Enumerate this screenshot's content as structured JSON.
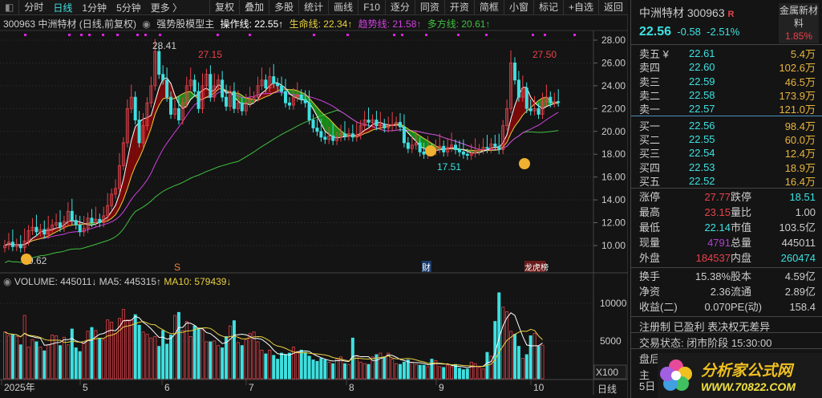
{
  "toolbar": {
    "left": [
      "分时",
      "日线",
      "1分钟",
      "5分钟",
      "更多 〉"
    ],
    "right": [
      "复权",
      "叠加",
      "多股",
      "统计",
      "画线",
      "F10",
      "逐分",
      "同资",
      "开资",
      "简框",
      "小窗",
      "标记",
      "+自选",
      "返回"
    ]
  },
  "info": {
    "title": "300963 中洲特材 (日线,前复权)",
    "model": "强势股模型主",
    "op": "操作线: 22.55↑",
    "life": "生命线: 22.34↑",
    "trend": "趋势线: 21.58↑",
    "multi": "多方线: 20.61↑"
  },
  "colors": {
    "up": "#e8414a",
    "down": "#3ee0e0",
    "ma5": "#ffffff",
    "ma10": "#e8d040",
    "ma20": "#d040e0",
    "ma60": "#40c040"
  },
  "chart_data": {
    "type": "candlestick",
    "ylim": [
      8,
      29
    ],
    "yticks": [
      "28.00",
      "26.00",
      "24.00",
      "22.00",
      "20.00",
      "18.00",
      "16.00",
      "14.00",
      "12.00",
      "10.00"
    ],
    "annotations": {
      "high": "28.41",
      "mid": "27.15",
      "recent": "27.50",
      "low": "17.51",
      "start_low": "9.62"
    },
    "markers": [
      "S",
      "财",
      "龙虎榜"
    ],
    "months": [
      "2025年",
      "5",
      "6",
      "7",
      "8",
      "9",
      "10"
    ],
    "close": [
      10.0,
      10.3,
      9.9,
      10.1,
      9.8,
      10.4,
      11.3,
      11.6,
      11.2,
      11.4,
      11.0,
      11.5,
      11.8,
      12.0,
      11.6,
      12.1,
      13.0,
      12.2,
      11.8,
      11.2,
      11.5,
      12.4,
      12.0,
      12.3,
      12.0,
      12.6,
      13.5,
      14.5,
      15.0,
      17.0,
      19.0,
      22.0,
      23.0,
      21.0,
      19.0,
      20.5,
      22.5,
      24.0,
      27.0,
      25.0,
      24.5,
      23.0,
      21.5,
      22.0,
      21.0,
      22.5,
      24.0,
      24.5,
      23.5,
      22.0,
      24.0,
      25.0,
      23.0,
      24.0,
      24.5,
      23.0,
      22.2,
      23.5,
      22.0,
      22.5,
      21.8,
      22.5,
      22.8,
      23.0,
      24.0,
      24.5,
      23.8,
      24.8,
      24.2,
      24.0,
      23.5,
      22.5,
      22.3,
      23.0,
      23.2,
      22.8,
      22.5,
      21.0,
      20.3,
      20.0,
      19.5,
      19.3,
      19.6,
      19.2,
      19.5,
      19.8,
      19.6,
      19.8,
      19.5,
      19.7,
      20.5,
      21.0,
      20.8,
      21.0,
      20.5,
      20.6,
      20.3,
      20.5,
      20.6,
      20.8,
      20.4,
      19.0,
      18.5,
      18.8,
      19.0,
      18.2,
      18.0,
      18.5,
      18.3,
      18.5,
      18.7,
      18.2,
      18.6,
      18.8,
      18.4,
      18.2,
      18.0,
      17.9,
      18.1,
      18.3,
      18.4,
      18.6,
      18.5,
      18.9,
      18.7,
      18.4,
      20.5,
      22.0,
      26.0,
      24.5,
      23.0,
      23.8,
      22.0,
      21.8,
      22.0,
      21.5,
      22.6,
      23.0,
      22.5,
      22.6,
      22.56
    ],
    "volume": {
      "ylim": [
        0,
        12000
      ],
      "yticks": [
        "10000",
        "5000"
      ],
      "unit": "X100",
      "values": [
        6200,
        5700,
        5800,
        5600,
        4500,
        8400,
        4200,
        5200,
        4900,
        4200,
        3700,
        4500,
        5800,
        5700,
        4400,
        5500,
        4500,
        6600,
        4100,
        3600,
        4700,
        6300,
        6800,
        6400,
        5300,
        5200,
        7800,
        7500,
        6000,
        8000,
        9200,
        7800,
        7800,
        8500,
        7100,
        6200,
        5900,
        5400,
        5600,
        4300,
        6400,
        4600,
        5800,
        8400,
        8800,
        6400,
        7600,
        5600,
        7000,
        6600,
        6500,
        4900,
        4900,
        5000,
        4400,
        4100,
        5600,
        7000,
        7700,
        4800,
        4400,
        5200,
        6000,
        6200,
        4900,
        3800,
        3300,
        3800,
        3100,
        2600,
        3400,
        3200,
        3400,
        4200,
        3600,
        3800,
        3500,
        3000,
        2500,
        2300,
        2700,
        2500,
        2200,
        2000,
        2600,
        2900,
        2000,
        1900,
        5400,
        3100,
        2200,
        2000,
        1900,
        2900,
        3200,
        3400,
        2900,
        3400,
        2600,
        2000,
        1900,
        2200,
        2500,
        2200,
        1900,
        1800,
        1800,
        1600,
        2600,
        2400,
        1600,
        1500,
        1800,
        1600,
        1900,
        1400,
        1200,
        1300,
        2200,
        2000,
        1500,
        1300,
        3500,
        3000,
        7600,
        11400,
        9500,
        8900,
        6300,
        5900,
        4300,
        2700,
        3200,
        5700,
        6000,
        4300,
        4450
      ]
    },
    "volume_header": {
      "vol": "VOLUME: 445011↓",
      "ma5": "MA5: 445315↑",
      "ma10": "MA10: 579439↓"
    }
  },
  "quote": {
    "name": "中洲特材 300963",
    "r": "R",
    "price": "22.56",
    "chg": "-0.58",
    "pct": "-2.51%",
    "sector": "金属新材料",
    "sector_pct": "1.85%",
    "asks": [
      {
        "l": "卖五 ¥",
        "p": "22.61",
        "v": "5.4万"
      },
      {
        "l": "卖四",
        "p": "22.60",
        "v": "102.6万"
      },
      {
        "l": "卖三",
        "p": "22.59",
        "v": "46.5万"
      },
      {
        "l": "卖二",
        "p": "22.58",
        "v": "173.9万"
      },
      {
        "l": "卖一",
        "p": "22.57",
        "v": "121.0万"
      }
    ],
    "bids": [
      {
        "l": "买一",
        "p": "22.56",
        "v": "98.4万"
      },
      {
        "l": "买二",
        "p": "22.55",
        "v": "60.0万"
      },
      {
        "l": "买三",
        "p": "22.54",
        "v": "12.4万"
      },
      {
        "l": "买四",
        "p": "22.53",
        "v": "18.9万"
      },
      {
        "l": "买五",
        "p": "22.52",
        "v": "16.4万"
      }
    ],
    "stats1": [
      [
        "涨停",
        "27.77",
        "跌停",
        "18.51"
      ],
      [
        "最高",
        "23.15",
        "量比",
        "1.00"
      ],
      [
        "最低",
        "22.14",
        "市值",
        "103.5亿"
      ],
      [
        "现量",
        "4791",
        "总量",
        "445011"
      ],
      [
        "外盘",
        "184537",
        "内盘",
        "260474"
      ]
    ],
    "stats2": [
      [
        "换手",
        "15.38%",
        "股本",
        "4.59亿"
      ],
      [
        "净资",
        "2.36",
        "流通",
        "2.89亿"
      ],
      [
        "收益(二)",
        "0.070",
        "PE(动)",
        "158.4"
      ]
    ],
    "tags": "注册制 已盈利 表决权无差异",
    "status": "交易状态: 闭市阶段 15:30:00",
    "cut1": "盘后",
    "cut2": "主",
    "cut3": "5日"
  },
  "period_label": "日线",
  "watermark": {
    "text": "分析家公式网",
    "url": "WWW.70822.COM"
  }
}
